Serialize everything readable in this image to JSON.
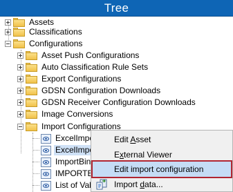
{
  "window": {
    "title": "Tree"
  },
  "tree": {
    "nodes": [
      {
        "label": "Assets",
        "expanded": false,
        "icon": "folder-icon"
      },
      {
        "label": "Classifications",
        "expanded": false,
        "icon": "folder-icon"
      },
      {
        "label": "Configurations",
        "expanded": true,
        "icon": "folder-icon"
      },
      {
        "label": "Asset Push Configurations",
        "expanded": false,
        "icon": "folder-icon"
      },
      {
        "label": "Auto Classification Rule Sets",
        "expanded": false,
        "icon": "folder-icon"
      },
      {
        "label": "Export Configurations",
        "expanded": false,
        "icon": "folder-icon"
      },
      {
        "label": "GDSN Configuration Downloads",
        "expanded": false,
        "icon": "folder-icon"
      },
      {
        "label": "GDSN Receiver Configuration Downloads",
        "expanded": false,
        "icon": "folder-icon"
      },
      {
        "label": "Image Conversions",
        "expanded": false,
        "icon": "folder-icon"
      },
      {
        "label": "Import Configurations",
        "expanded": true,
        "icon": "folder-icon"
      },
      {
        "label": "ExcelImpo",
        "icon": "import-config-icon"
      },
      {
        "label": "ExcelImpo",
        "icon": "import-config-icon",
        "selected": true
      },
      {
        "label": "ImportBina",
        "icon": "import-config-icon"
      },
      {
        "label": "IMPORTED",
        "icon": "import-config-icon"
      },
      {
        "label": "List of Valu",
        "icon": "import-config-icon"
      }
    ]
  },
  "context_menu": {
    "items": [
      {
        "label_pre": "Edit ",
        "label_u": "A",
        "label_post": "sset"
      },
      {
        "label_pre": "E",
        "label_u": "x",
        "label_post": "ternal Viewer"
      },
      {
        "label_pre": "Edit import configuration",
        "label_u": "",
        "label_post": "",
        "highlighted": true
      },
      {
        "label_pre": "Import ",
        "label_u": "d",
        "label_post": "ata...",
        "icon": "import-data-icon"
      }
    ],
    "highlight_color": "#b02531"
  },
  "colors": {
    "titlebar": "#0e65b5",
    "selection": "#cfe1f6",
    "menu_hover": "#c5dcf5"
  }
}
